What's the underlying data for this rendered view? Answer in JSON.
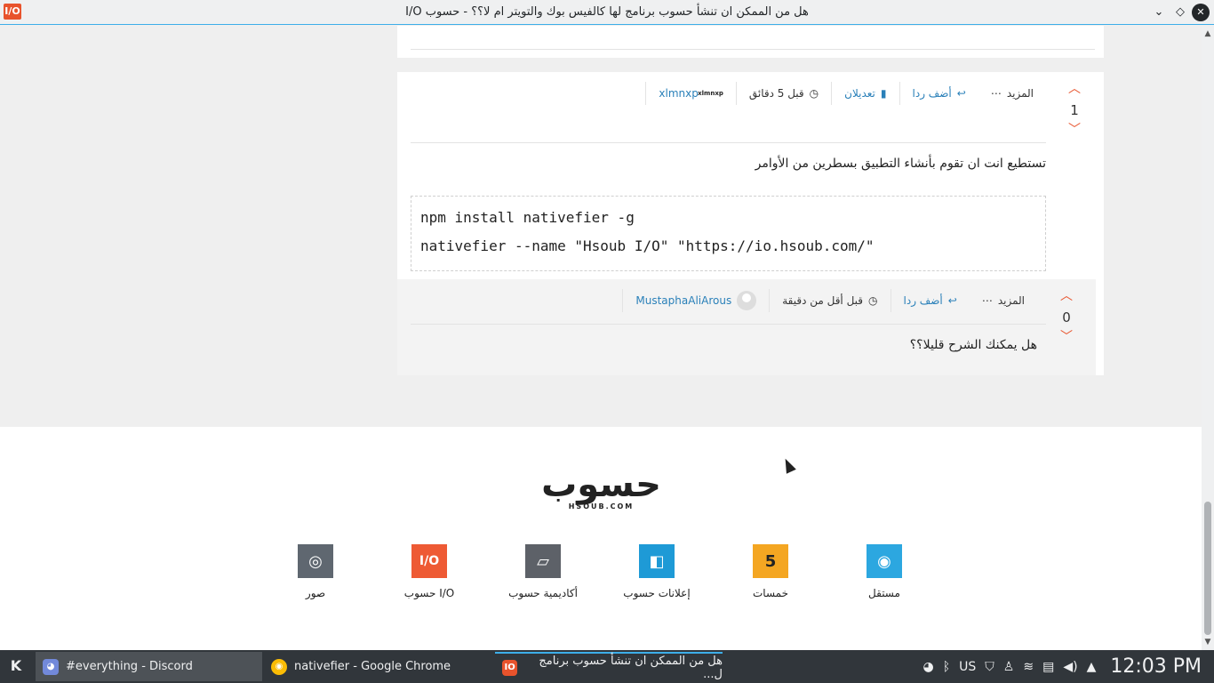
{
  "window": {
    "title": "هل من الممكن ان تنشأ حسوب برنامج لها كالفيس بوك والتويتر ام لا؟؟ - حسوب I/O",
    "app_badge": "I/O",
    "btn_minimize": "⌄",
    "btn_maximize": "◇",
    "btn_close": "✕"
  },
  "answers": [
    {
      "vote_count": "1",
      "username": "xlmnxp",
      "avatar_text": "xlmnxp",
      "time": "قبل 5 دقائق",
      "edits_label": "تعديلان",
      "reply_label": "أضف ردا",
      "more_label": "المزيد",
      "text": "تستطيع انت ان تقوم بأنشاء التطبيق بسطرين من الأوامر",
      "code": [
        "npm install nativefier -g",
        "nativefier --name \"Hsoub I/O\" \"https://io.hsoub.com/\""
      ]
    },
    {
      "vote_count": "0",
      "username": "MustaphaAliArous",
      "time": "قبل أقل من دقيقة",
      "reply_label": "أضف ردا",
      "more_label": "المزيد",
      "text": "هل يمكنك الشرح قليلا؟؟"
    }
  ],
  "footer": {
    "logo_ar": "حسوب",
    "logo_en": "HSOUB.COM",
    "services": [
      {
        "label": "مستقل",
        "color": "#2ca7e0",
        "glyph": "◉"
      },
      {
        "label": "خمسات",
        "color": "#f4a622",
        "glyph": "5"
      },
      {
        "label": "إعلانات حسوب",
        "color": "#1e9ad6",
        "glyph": "◧"
      },
      {
        "label": "أكاديمية حسوب",
        "color": "#5d6168",
        "glyph": "▱"
      },
      {
        "label": "حسوب I/O",
        "color": "#ee5a34",
        "glyph": "I/O"
      },
      {
        "label": "صور",
        "color": "#5f6770",
        "glyph": "◎"
      }
    ]
  },
  "taskbar": {
    "tasks": [
      {
        "label": "#everything - Discord"
      },
      {
        "label": "nativefier - Google Chrome"
      },
      {
        "label": "هل من الممكن ان تنشأ حسوب برنامج ل..."
      }
    ],
    "keyboard_layout": "US",
    "clock": "12:03 PM"
  },
  "icons": {
    "vote_up": "chevron-up-icon",
    "vote_down": "chevron-down-icon",
    "clock": "clock-icon",
    "reply": "reply-icon",
    "edits": "book-icon",
    "more": "ellipsis-icon"
  }
}
